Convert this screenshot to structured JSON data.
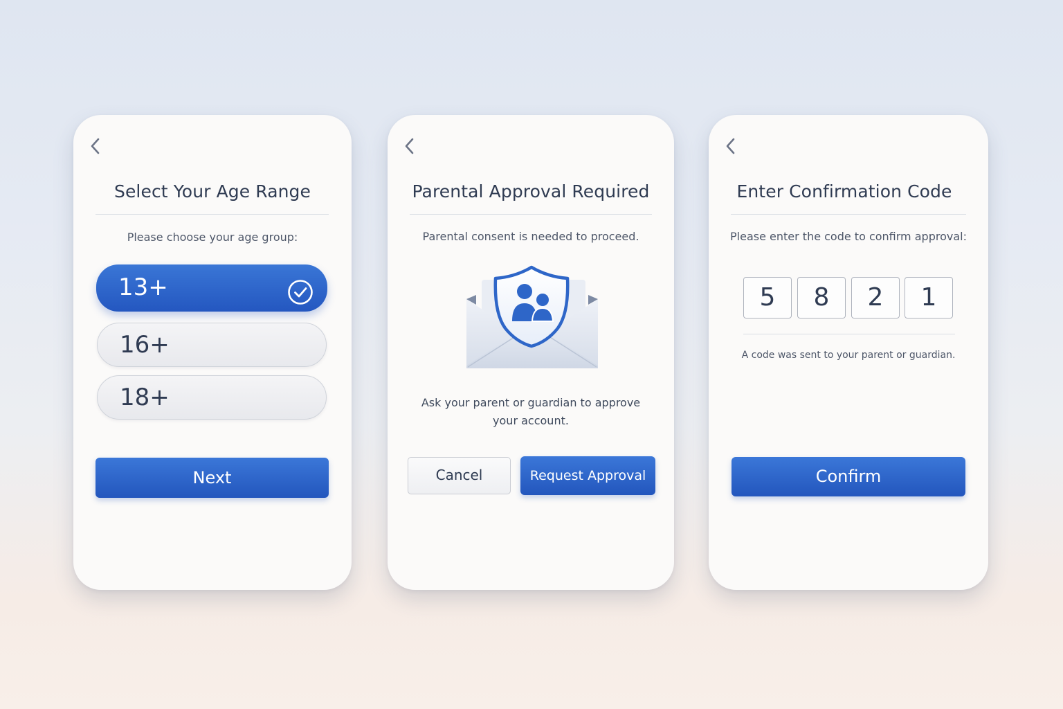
{
  "age_screen": {
    "title": "Select Your Age Range",
    "subtitle": "Please choose your age group:",
    "options": [
      {
        "label": "13+",
        "selected": true
      },
      {
        "label": "16+",
        "selected": false
      },
      {
        "label": "18+",
        "selected": false
      }
    ],
    "next_label": "Next"
  },
  "approval_screen": {
    "title": "Parental Approval Required",
    "subtitle": "Parental consent is needed to proceed.",
    "illustration": "envelope-shield-family-icon",
    "body": "Ask your parent or guardian to approve your account.",
    "cancel_label": "Cancel",
    "request_label": "Request Approval"
  },
  "code_screen": {
    "title": "Enter Confirmation Code",
    "subtitle": "Please enter the code to confirm approval:",
    "digits": [
      "5",
      "8",
      "2",
      "1"
    ],
    "hint": "A code was sent to your parent or guardian.",
    "confirm_label": "Confirm"
  },
  "icons": {
    "back": "chevron-left-icon",
    "selected": "check-circle-icon"
  },
  "colors": {
    "accent": "#2a5fc8",
    "accent_light": "#3b77d8",
    "text": "#2f3b52",
    "card": "#fbfaf9"
  }
}
